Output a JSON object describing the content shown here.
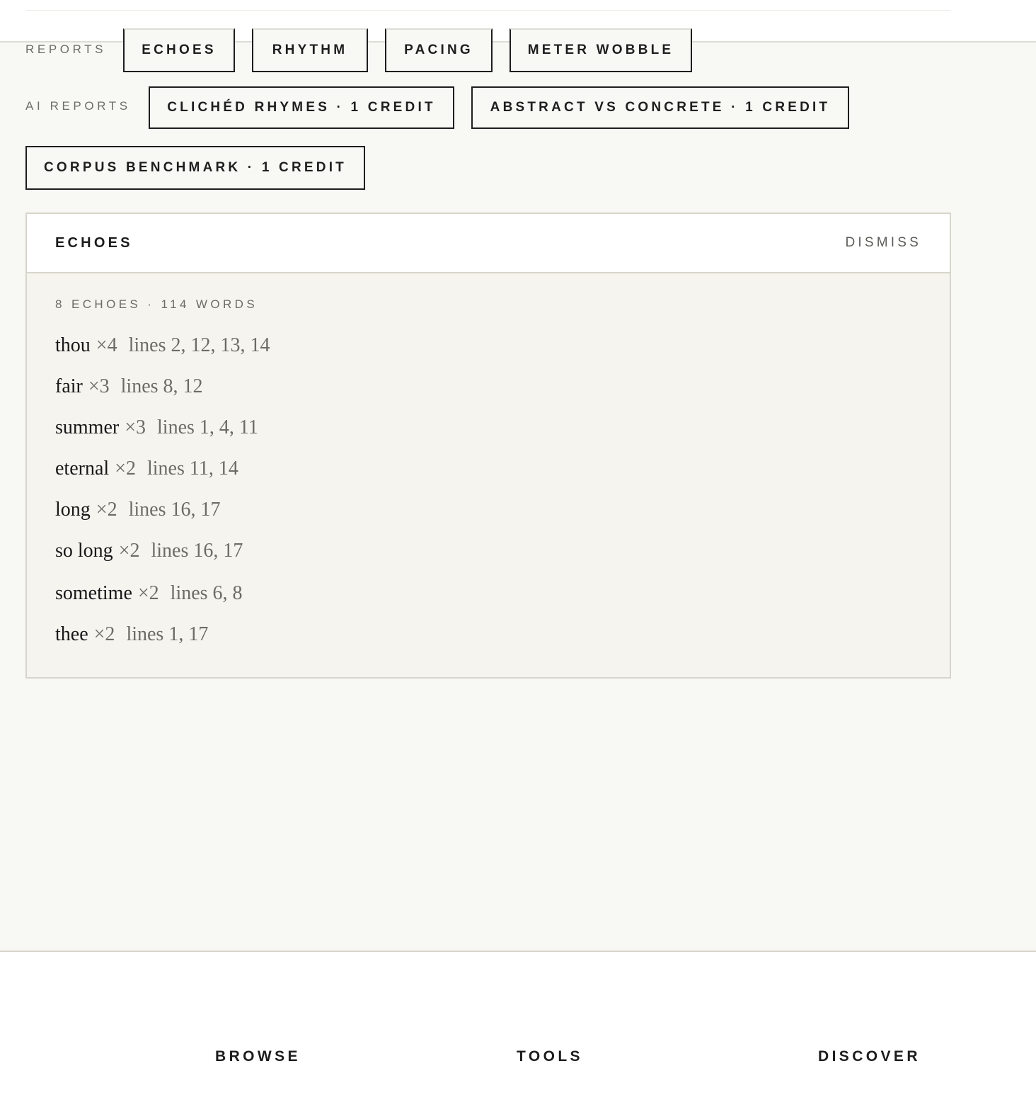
{
  "reports": {
    "label": "REPORTS",
    "buttons": [
      "ECHOES",
      "RHYTHM",
      "PACING",
      "METER WOBBLE"
    ]
  },
  "ai_reports": {
    "label": "AI REPORTS",
    "buttons": [
      "CLICHÉD RHYMES · 1 CREDIT",
      "ABSTRACT VS CONCRETE · 1 CREDIT",
      "CORPUS BENCHMARK · 1 CREDIT"
    ]
  },
  "panel": {
    "title": "ECHOES",
    "dismiss_label": "DISMISS",
    "summary": "8 ECHOES · 114 WORDS",
    "echoes": [
      {
        "word": "thou",
        "count": "×4",
        "lines": "lines 2, 12, 13, 14"
      },
      {
        "word": "fair",
        "count": "×3",
        "lines": "lines 8, 12"
      },
      {
        "word": "summer",
        "count": "×3",
        "lines": "lines 1, 4, 11"
      },
      {
        "word": "eternal",
        "count": "×2",
        "lines": "lines 11, 14"
      },
      {
        "word": "long",
        "count": "×2",
        "lines": "lines 16, 17"
      },
      {
        "word": "so long",
        "count": "×2",
        "lines": "lines 16, 17"
      },
      {
        "word": "sometime",
        "count": "×2",
        "lines": "lines 6, 8"
      },
      {
        "word": "thee",
        "count": "×2",
        "lines": "lines 1, 17"
      }
    ]
  },
  "footer": {
    "links": [
      "BROWSE",
      "TOOLS",
      "DISCOVER"
    ]
  }
}
